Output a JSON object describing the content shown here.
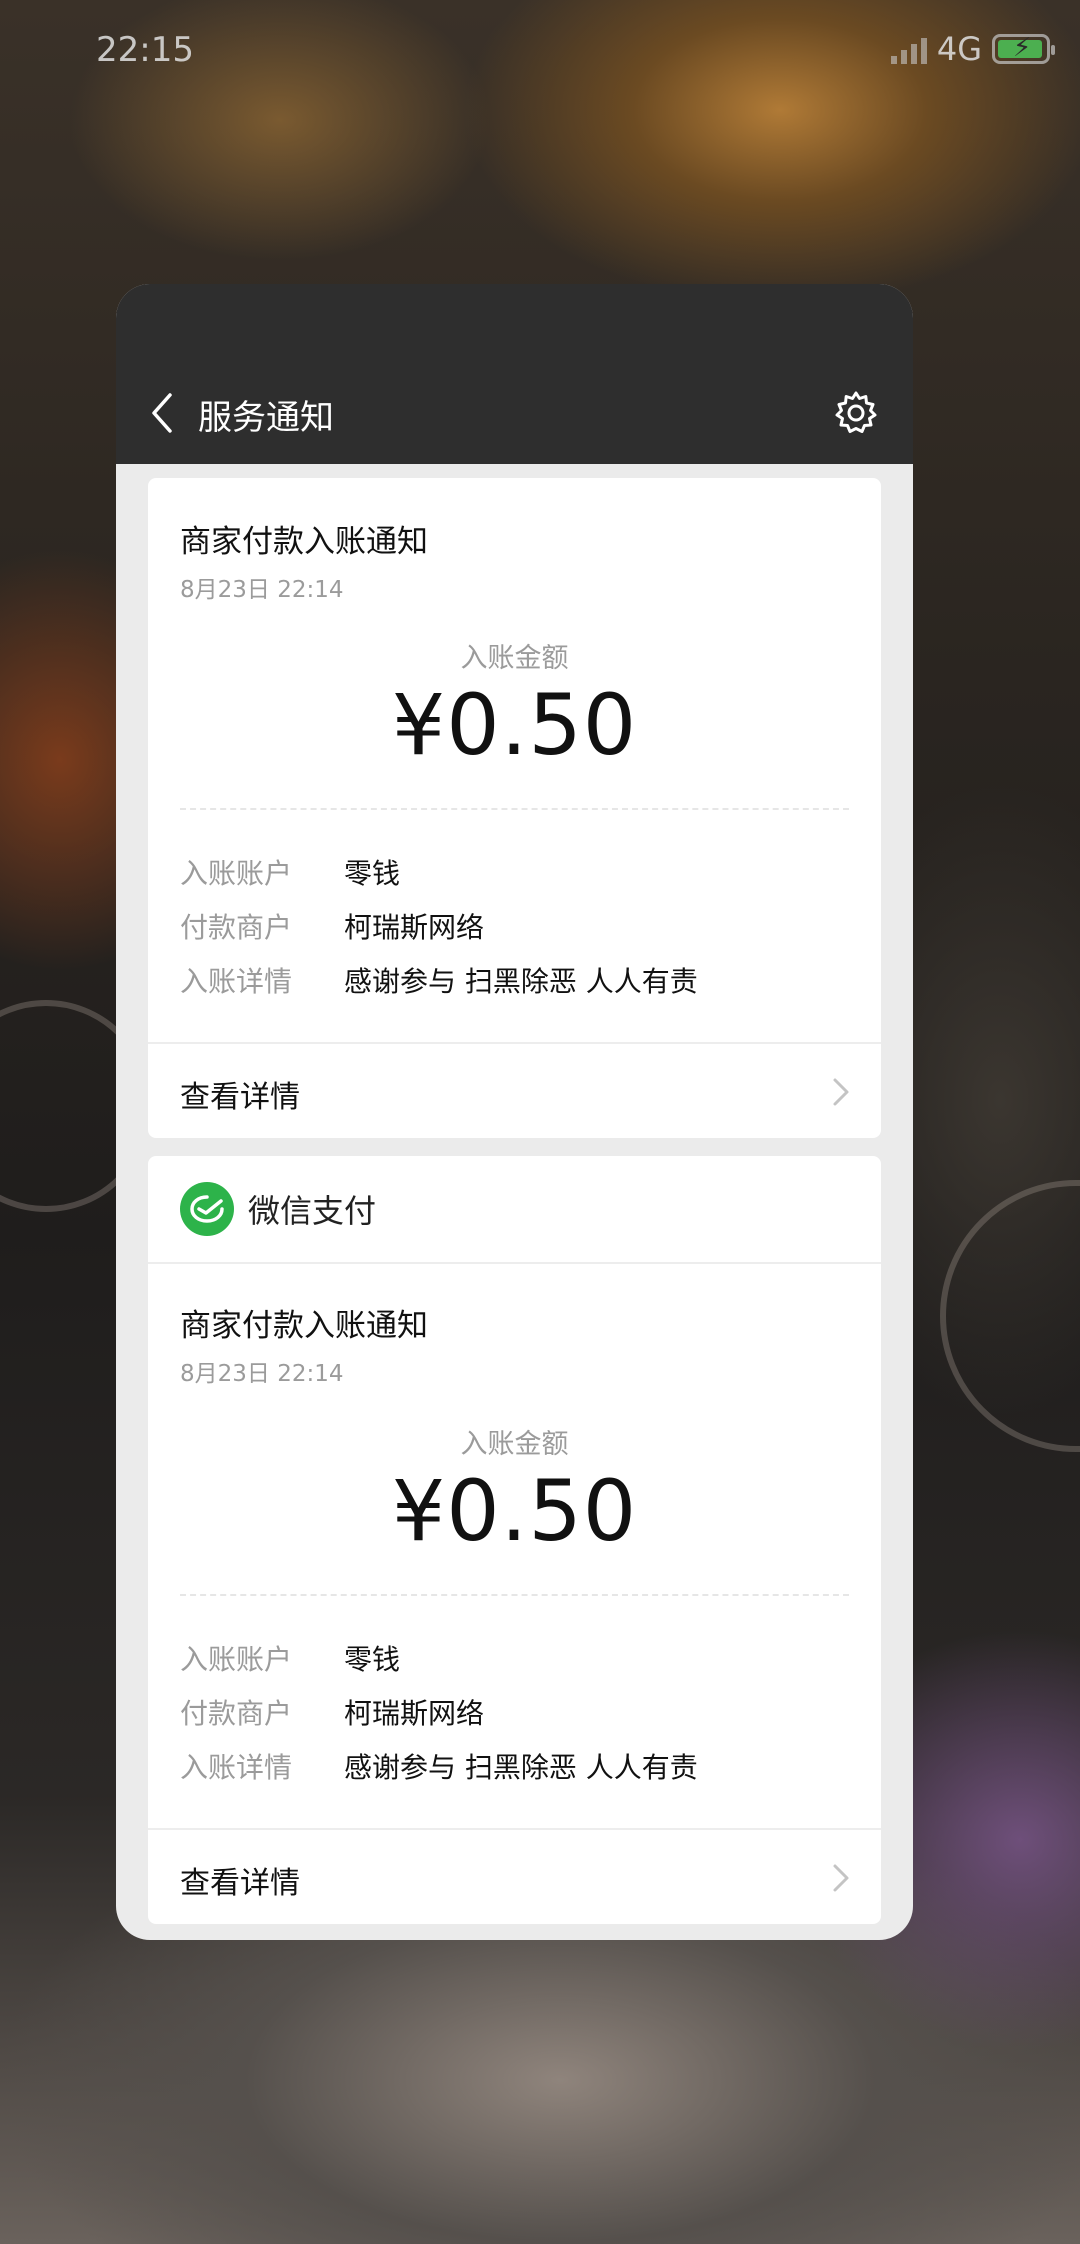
{
  "status_bar": {
    "time": "22:15",
    "network": "4G"
  },
  "header": {
    "title": "服务通知"
  },
  "notifications": [
    {
      "title": "商家付款入账通知",
      "time": "8月23日  22:14",
      "amount_label": "入账金额",
      "amount": "¥0.50",
      "rows": [
        {
          "key": "入账账户",
          "value": "零钱"
        },
        {
          "key": "付款商户",
          "value": "柯瑞斯网络"
        },
        {
          "key": "入账详情",
          "value": "感谢参与 扫黑除恶 人人有责"
        }
      ],
      "detail_label": "查看详情"
    },
    {
      "source": "微信支付",
      "title": "商家付款入账通知",
      "time": "8月23日  22:14",
      "amount_label": "入账金额",
      "amount": "¥0.50",
      "rows": [
        {
          "key": "入账账户",
          "value": "零钱"
        },
        {
          "key": "付款商户",
          "value": "柯瑞斯网络"
        },
        {
          "key": "入账详情",
          "value": "感谢参与 扫黑除恶 人人有责"
        }
      ],
      "detail_label": "查看详情"
    }
  ],
  "colors": {
    "header_bg": "#2e2e2e",
    "wechat_pay_green": "#2db34a",
    "battery_green": "#4caf50"
  },
  "icons": [
    "back-arrow-icon",
    "settings-gear-icon",
    "wechat-pay-icon",
    "chevron-right-icon"
  ]
}
